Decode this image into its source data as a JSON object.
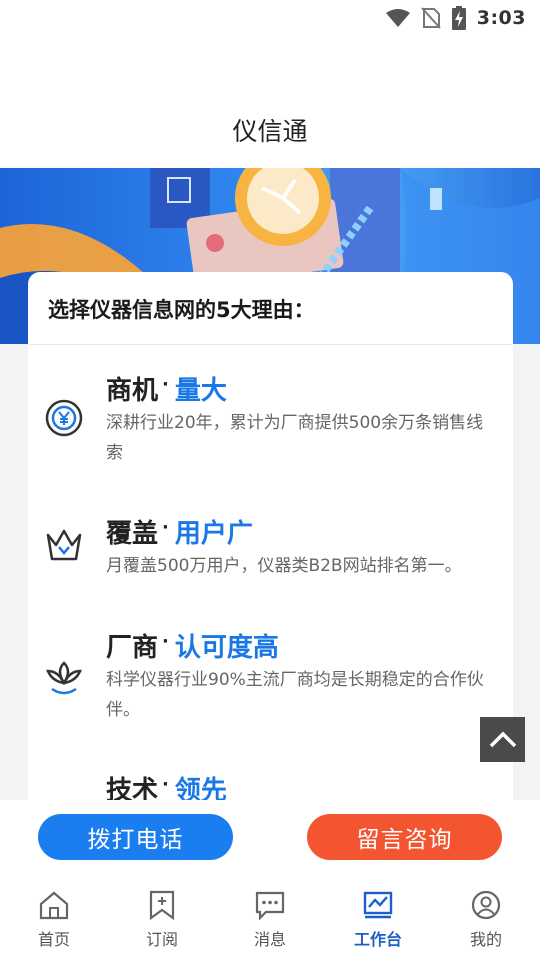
{
  "status_bar": {
    "time": "3:03"
  },
  "header": {
    "title": "仪信通"
  },
  "card": {
    "heading": "选择仪器信息网的5大理由：",
    "reasons": [
      {
        "title_main": "商机",
        "title_dot": "·",
        "title_accent": "量大",
        "description": "深耕行业20年，累计为厂商提供500余万条销售线索",
        "icon": "yen-icon"
      },
      {
        "title_main": "覆盖",
        "title_dot": "·",
        "title_accent": "用户广",
        "description": "月覆盖500万用户，仪器类B2B网站排名第一。",
        "icon": "crown-icon"
      },
      {
        "title_main": "厂商",
        "title_dot": "·",
        "title_accent": "认可度高",
        "description": "科学仪器行业90%主流厂商均是长期稳定的合作伙伴。",
        "icon": "lotus-icon"
      },
      {
        "title_main": "技术",
        "title_dot": "·",
        "title_accent": "领先",
        "description": "",
        "icon": ""
      }
    ]
  },
  "actions": {
    "call_label": "拨打电话",
    "consult_label": "留言咨询"
  },
  "tabs": [
    {
      "label": "首页",
      "icon": "home-icon"
    },
    {
      "label": "订阅",
      "icon": "bookmark-icon"
    },
    {
      "label": "消息",
      "icon": "message-icon"
    },
    {
      "label": "工作台",
      "icon": "workbench-icon",
      "active": true
    },
    {
      "label": "我的",
      "icon": "profile-icon"
    }
  ],
  "colors": {
    "accent": "#1a78e6",
    "call": "#1a7ef0",
    "consult": "#f45531",
    "tab_active": "#1a60c8"
  }
}
